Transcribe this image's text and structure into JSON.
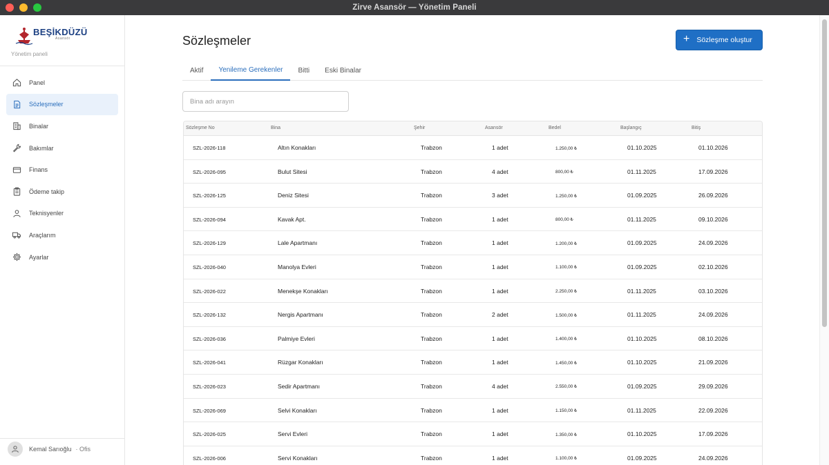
{
  "window": {
    "title": "Zirve Asansör — Yönetim Paneli"
  },
  "brand": {
    "logo_text": "BEŞİKDÜZÜ",
    "logo_sub": "Asansör",
    "subtitle": "Yönetim paneli"
  },
  "sidebar": {
    "items": [
      {
        "label": "Panel",
        "icon": "home-icon"
      },
      {
        "label": "Sözleşmeler",
        "icon": "document-icon",
        "active": true
      },
      {
        "label": "Binalar",
        "icon": "building-icon"
      },
      {
        "label": "Bakımlar",
        "icon": "wrench-icon"
      },
      {
        "label": "Finans",
        "icon": "card-icon"
      },
      {
        "label": "Ödeme takip",
        "icon": "clipboard-icon"
      },
      {
        "label": "Teknisyenler",
        "icon": "person-icon"
      },
      {
        "label": "Araçlarım",
        "icon": "truck-icon"
      },
      {
        "label": "Ayarlar",
        "icon": "gear-icon"
      }
    ]
  },
  "user": {
    "name": "Kemal Sarıoğlu",
    "role": "· Ofis"
  },
  "page": {
    "title": "Sözleşmeler",
    "create_button": "Sözleşme oluştur"
  },
  "tabs": [
    {
      "label": "Aktif"
    },
    {
      "label": "Yenileme Gerekenler",
      "active": true
    },
    {
      "label": "Bitti"
    },
    {
      "label": "Eski Binalar"
    }
  ],
  "search": {
    "placeholder": "Bina adı arayın",
    "value": ""
  },
  "table": {
    "columns": [
      "Sözleşme No",
      "Bina",
      "Şehir",
      "Asansör",
      "Bedel",
      "Başlangıç",
      "Bitiş"
    ],
    "rows": [
      [
        "SZL-2026-118",
        "Altın Konakları",
        "Trabzon",
        "1 adet",
        "1.250,00 ₺",
        "01.10.2025",
        "01.10.2026"
      ],
      [
        "SZL-2026-095",
        "Bulut Sitesi",
        "Trabzon",
        "4 adet",
        "800,00 ₺",
        "01.11.2025",
        "17.09.2026"
      ],
      [
        "SZL-2026-125",
        "Deniz Sitesi",
        "Trabzon",
        "3 adet",
        "1.250,00 ₺",
        "01.09.2025",
        "26.09.2026"
      ],
      [
        "SZL-2026-094",
        "Kavak Apt.",
        "Trabzon",
        "1 adet",
        "800,00 ₺",
        "01.11.2025",
        "09.10.2026"
      ],
      [
        "SZL-2026-129",
        "Lale Apartmanı",
        "Trabzon",
        "1 adet",
        "1.200,00 ₺",
        "01.09.2025",
        "24.09.2026"
      ],
      [
        "SZL-2026-040",
        "Manolya Evleri",
        "Trabzon",
        "1 adet",
        "1.100,00 ₺",
        "01.09.2025",
        "02.10.2026"
      ],
      [
        "SZL-2026-022",
        "Menekşe Konakları",
        "Trabzon",
        "1 adet",
        "2.250,00 ₺",
        "01.11.2025",
        "03.10.2026"
      ],
      [
        "SZL-2026-132",
        "Nergis Apartmanı",
        "Trabzon",
        "2 adet",
        "1.500,00 ₺",
        "01.11.2025",
        "24.09.2026"
      ],
      [
        "SZL-2026-036",
        "Palmiye Evleri",
        "Trabzon",
        "1 adet",
        "1.400,00 ₺",
        "01.10.2025",
        "08.10.2026"
      ],
      [
        "SZL-2026-041",
        "Rüzgar Konakları",
        "Trabzon",
        "1 adet",
        "1.450,00 ₺",
        "01.10.2025",
        "21.09.2026"
      ],
      [
        "SZL-2026-023",
        "Sedir Apartmanı",
        "Trabzon",
        "4 adet",
        "2.550,00 ₺",
        "01.09.2025",
        "29.09.2026"
      ],
      [
        "SZL-2026-069",
        "Selvi Konakları",
        "Trabzon",
        "1 adet",
        "1.150,00 ₺",
        "01.11.2025",
        "22.09.2026"
      ],
      [
        "SZL-2026-025",
        "Servi Evleri",
        "Trabzon",
        "1 adet",
        "1.350,00 ₺",
        "01.10.2025",
        "17.09.2026"
      ],
      [
        "SZL-2026-006",
        "Servi Konakları",
        "Trabzon",
        "1 adet",
        "1.100,00 ₺",
        "01.09.2025",
        "24.09.2026"
      ]
    ]
  },
  "colors": {
    "accent": "#2a6ebc",
    "button": "#1f6fc5",
    "active_nav_bg": "#e9f1fb"
  }
}
